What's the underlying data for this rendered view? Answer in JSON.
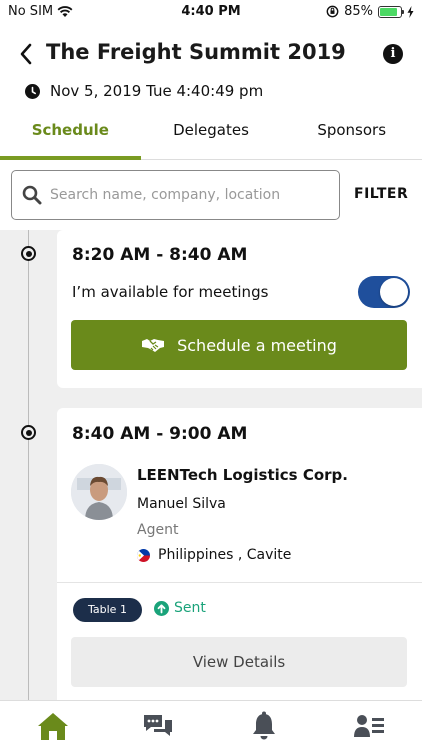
{
  "status_bar": {
    "carrier": "No SIM",
    "time": "4:40 PM",
    "battery": "85%",
    "battery_level": 0.85
  },
  "header": {
    "title": "The Freight Summit 2019",
    "info_icon": "info-icon",
    "info_glyph": "i"
  },
  "datetime": "Nov 5, 2019 Tue 4:40:49 pm",
  "tabs": [
    {
      "label": "Schedule",
      "active": true
    },
    {
      "label": "Delegates",
      "active": false
    },
    {
      "label": "Sponsors",
      "active": false
    }
  ],
  "search": {
    "placeholder": "Search name, company, location",
    "value": "",
    "filter_label": "FILTER"
  },
  "slots": [
    {
      "time": "8:20 AM - 8:40 AM",
      "availability_label": "I’m available for meetings",
      "available": true,
      "button_label": "Schedule a meeting"
    },
    {
      "time": "8:40 AM - 9:00 AM",
      "company": "LEENTech Logistics Corp.",
      "person": "Manuel Silva",
      "role": "Agent",
      "location": "Philippines , Cavite",
      "table": "Table 1",
      "status": "Sent",
      "button_label": "View Details"
    }
  ],
  "bottom_nav": [
    {
      "icon": "home-icon",
      "active": true
    },
    {
      "icon": "chat-icon",
      "active": false
    },
    {
      "icon": "bell-icon",
      "active": false
    },
    {
      "icon": "contacts-icon",
      "active": false
    }
  ],
  "colors": {
    "accent_green": "#6a8a1b",
    "toggle_blue": "#1f4f9c",
    "status_sent": "#1aa37a",
    "badge_navy": "#1c2e4a"
  }
}
